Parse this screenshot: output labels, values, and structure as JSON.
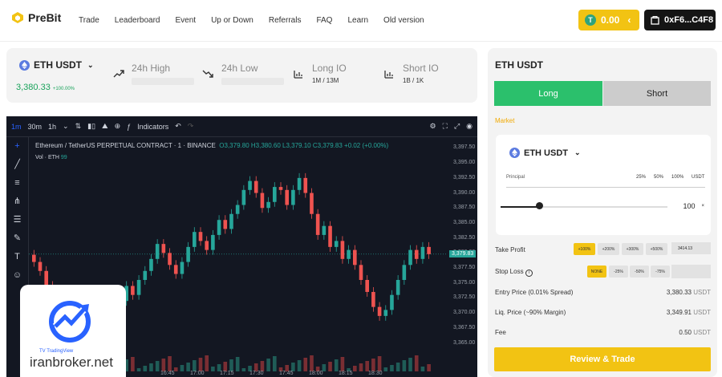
{
  "header": {
    "brand": "PreBit",
    "nav": [
      "Trade",
      "Leaderboard",
      "Event",
      "Up or Down",
      "Referrals",
      "FAQ",
      "Learn",
      "Old version"
    ],
    "balance": "0.00",
    "wallet": "0xF6...C4F8"
  },
  "stats": {
    "pair": "ETH USDT",
    "price": "3,380.33",
    "change": "+100.00%",
    "high_label": "24h High",
    "low_label": "24h Low",
    "long_label": "Long IO",
    "long_value": "1M / 13M",
    "short_label": "Short IO",
    "short_value": "1B / 1K"
  },
  "chart_toolbar": {
    "intervals": [
      "1m",
      "30m",
      "1h"
    ],
    "active_interval": "1m",
    "indicators": "Indicators"
  },
  "chart": {
    "legend_title": "Ethereum / TetherUS PERPETUAL CONTRACT · 1 · BINANCE",
    "ohlc": {
      "o": "3,379.80",
      "h": "3,380.60",
      "l": "3,379.10",
      "c": "3,379.83",
      "chg": "+0.02 (+0.00%)"
    },
    "volume_label": "Vol · ETH",
    "volume_value": "99",
    "last_price": "3,379.83",
    "watermark": "iranbroker.net",
    "watermark_small": "TV TradingView"
  },
  "chart_data": {
    "type": "candlestick",
    "y_ticks": [
      "3,397.50",
      "3,395.00",
      "3,392.50",
      "3,390.00",
      "3,387.50",
      "3,385.00",
      "3,382.50",
      "3,380.00",
      "3,377.50",
      "3,375.00",
      "3,372.50",
      "3,370.00",
      "3,367.50",
      "3,365.00"
    ],
    "x_ticks": [
      "16:45",
      "17:00",
      "17:15",
      "17:30",
      "17:45",
      "18:00",
      "18:15",
      "18:30"
    ],
    "ylim": [
      3364,
      3398.5
    ],
    "close": [
      3378.5,
      3377.0,
      3374.5,
      3373.0,
      3371.0,
      3368.5,
      3366.5,
      3367.5,
      3369.0,
      3371.5,
      3372.0,
      3370.5,
      3368.0,
      3369.5,
      3372.0,
      3374.5,
      3373.0,
      3375.5,
      3377.0,
      3379.0,
      3381.5,
      3380.0,
      3378.0,
      3376.5,
      3378.5,
      3381.0,
      3383.5,
      3382.0,
      3380.5,
      3383.0,
      3385.5,
      3384.0,
      3386.5,
      3388.0,
      3390.5,
      3392.0,
      3390.0,
      3387.5,
      3388.5,
      3391.0,
      3390.5,
      3388.0,
      3390.5,
      3392.5,
      3390.0,
      3386.5,
      3383.0,
      3384.5,
      3381.0,
      3382.0,
      3379.0,
      3380.5,
      3378.0,
      3375.5,
      3373.5,
      3371.0,
      3369.5,
      3370.5,
      3373.0,
      3375.5,
      3378.0,
      3380.5,
      3379.0,
      3381.0,
      3379.8
    ]
  },
  "order": {
    "title": "ETH USDT",
    "long": "Long",
    "short": "Short",
    "type": "Market",
    "pair": "ETH USDT",
    "principal_label": "Principal",
    "pcts": [
      "25%",
      "50%",
      "100%"
    ],
    "unit": "USDT",
    "amount": "100",
    "slider_fraction": 0.23,
    "take_profit_label": "Take Profit",
    "tp_chips": [
      "+100%",
      "+200%",
      "+300%",
      "+500%"
    ],
    "tp_value": "3414.13",
    "stop_loss_label": "Stop Loss",
    "sl_chips": [
      "NONE",
      "-25%",
      "-50%",
      "-75%"
    ],
    "entry_label": "Entry Price (0.01% Spread)",
    "entry_value": "3,380.33",
    "liq_label": "Liq. Price (~90% Margin)",
    "liq_value": "3,349.91",
    "fee_label": "Fee",
    "fee_value": "0.50",
    "review": "Review & Trade"
  }
}
